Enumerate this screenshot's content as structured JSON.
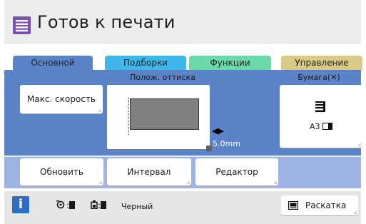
{
  "header": {
    "title": "Готов к печати",
    "icon": "document-list-icon"
  },
  "tabs": [
    {
      "label": "Основной",
      "color": "#5b84c8",
      "active": true
    },
    {
      "label": "Подборки",
      "color": "#3fb7ea",
      "active": false
    },
    {
      "label": "Функции",
      "color": "#6cd9a9",
      "active": false
    },
    {
      "label": "Управление",
      "color": "#d9cb86",
      "active": false
    }
  ],
  "main": {
    "max_speed_label": "Макс. скорость",
    "position_label": "Полож. оттиска",
    "position_value": "5.0mm",
    "paper_label": "Бумага(✕)",
    "paper_size": "A3",
    "paper_icon": "paper-tray-icon"
  },
  "actions": {
    "update_label": "Обновить",
    "interval_label": "Интервал",
    "editor_label": "Редактор"
  },
  "status": {
    "info_icon": "i",
    "drum_separator": ":",
    "ink_separator": ":",
    "color_label": "Черный",
    "collate_label": "Раскатка"
  },
  "colors": {
    "accent_purple": "#7b4fb3",
    "panel_blue": "#5b84c8",
    "panel_light_blue": "#9db3e3",
    "info_blue": "#2f6fc3"
  }
}
